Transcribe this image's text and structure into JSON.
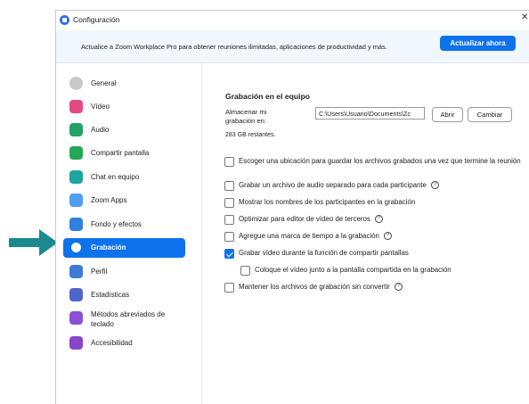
{
  "window": {
    "title": "Configuración"
  },
  "banner": {
    "text": "Actualice a Zoom Workplace Pro para obtener reuniones ilimitadas, aplicaciones de productividad y más.",
    "button": "Actualizar ahora"
  },
  "sidebar": {
    "items": [
      {
        "label": "General",
        "icon": "gear-icon",
        "color": "#bdbdbd"
      },
      {
        "label": "Vídeo",
        "icon": "video-camera-icon",
        "color": "#e64980"
      },
      {
        "label": "Audio",
        "icon": "headphones-icon",
        "color": "#21a366"
      },
      {
        "label": "Compartir pantalla",
        "icon": "share-screen-icon",
        "color": "#22a757"
      },
      {
        "label": "Chat en equipo",
        "icon": "chat-bubble-icon",
        "color": "#1fa4a0"
      },
      {
        "label": "Zoom Apps",
        "icon": "apps-icon",
        "color": "#4f9ef5"
      },
      {
        "label": "Fondo y efectos",
        "icon": "background-icon",
        "color": "#2e7fe0"
      },
      {
        "label": "Grabación",
        "icon": "record-icon",
        "color": "#0e72ed",
        "active": true
      },
      {
        "label": "Perfil",
        "icon": "user-icon",
        "color": "#3e7ad8"
      },
      {
        "label": "Estadísticas",
        "icon": "bar-chart-icon",
        "color": "#4e66c9"
      },
      {
        "label": "Métodos abreviados de teclado",
        "icon": "keyboard-icon",
        "color": "#8c4fd6"
      },
      {
        "label": "Accesibilidad",
        "icon": "accessibility-icon",
        "color": "#8a46c9"
      }
    ]
  },
  "recording": {
    "section_title": "Grabación en el equipo",
    "store_label": "Almacenar mi grabación en:",
    "path_value": "C:\\Users\\Usuario\\Documents\\Zc",
    "open_button": "Abrir",
    "change_button": "Cambiar",
    "remaining": "283 GB restantes.",
    "options": [
      {
        "label": "Escoger una ubicación para guardar los archivos grabados una vez que termine la reunión",
        "checked": false,
        "help": false
      },
      {
        "label": "Grabar un archivo de audio separado para cada participante",
        "checked": false,
        "help": true
      },
      {
        "label": "Mostrar los nombres de los participantes en la grabación",
        "checked": false,
        "help": false
      },
      {
        "label": "Optimizar para editor de vídeo de terceros",
        "checked": false,
        "help": true
      },
      {
        "label": "Agregue una marca de tiempo a la grabación",
        "checked": false,
        "help": true
      },
      {
        "label": "Grabar vídeo durante la función de compartir pantallas",
        "checked": true,
        "help": false
      },
      {
        "label": "Coloque el vídeo junto a la pantalla compartida en la grabación",
        "checked": false,
        "help": false
      },
      {
        "label": "Mantener los archivos de grabación sin convertir",
        "checked": false,
        "help": true
      }
    ]
  },
  "colors": {
    "accent": "#0e72ed",
    "banner_bg": "#f0f7ff",
    "annotation_arrow": "#1a8a8f"
  }
}
